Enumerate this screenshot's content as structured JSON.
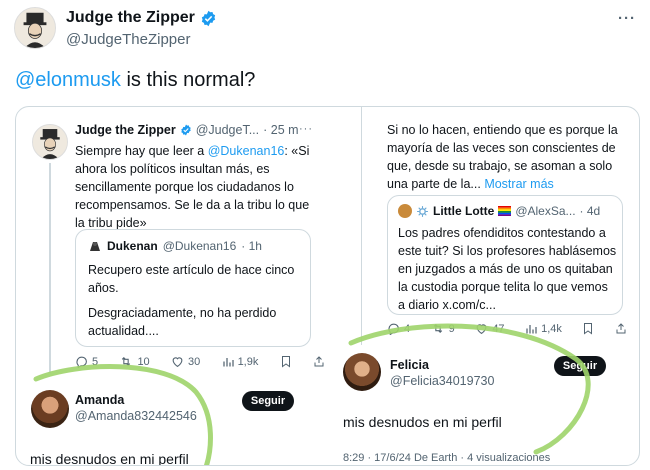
{
  "main": {
    "name": "Judge the Zipper",
    "handle": "@JudgeTheZipper",
    "mention": "@elonmusk",
    "text": " is this normal?",
    "more": "···"
  },
  "left": {
    "name": "Judge the Zipper",
    "handle": "@JudgeT...",
    "time": "· 25 m",
    "more": "···",
    "text_pre": "Siempre hay que leer a ",
    "text_mention": "@Dukenan16",
    "text_post": ": «Si ahora los políticos insultan más, es sencillamente porque los ciudadanos lo recompensamos. Se le da a la tribu lo que la tribu pide»",
    "quote": {
      "name": "Dukenan",
      "handle": "@Dukenan16",
      "time": "· 1h",
      "line1": "Recupero este artículo de hace cinco años.",
      "line2": "Desgraciadamente, no ha perdido actualidad...."
    },
    "actions": {
      "replies": "5",
      "retweets": "10",
      "likes": "30",
      "views": "1,9k"
    }
  },
  "right": {
    "text": "Si no lo hacen, entiendo que es porque la mayoría de las veces son conscientes de que, desde su trabajo, se asoman a solo una parte de la...",
    "show_more": "Mostrar más",
    "quote": {
      "name": "Little Lotte",
      "handle": "@AlexSa...",
      "time": "· 4d",
      "text": "Los padres ofendiditos contestando a este tuit? Si los profesores hablásemos en juzgados a más de uno os quitaban la custodia porque telita lo que vemos a diario x.com/c..."
    },
    "actions": {
      "replies": "4",
      "retweets": "9",
      "likes": "47",
      "views": "1,4k"
    }
  },
  "reply_left": {
    "name": "Amanda",
    "handle": "@Amanda832442546",
    "follow": "Seguir",
    "text": "mis desnudos en mi perfil"
  },
  "reply_right": {
    "name": "Felicia",
    "handle": "@Felicia34019730",
    "follow": "Seguir",
    "text": "mis desnudos en mi perfil",
    "footer": "8:29 · 17/6/24 De Earth · 4 visualizaciones"
  },
  "colors": {
    "accent": "#1d9bf0",
    "highlight": "#9ed46a"
  }
}
